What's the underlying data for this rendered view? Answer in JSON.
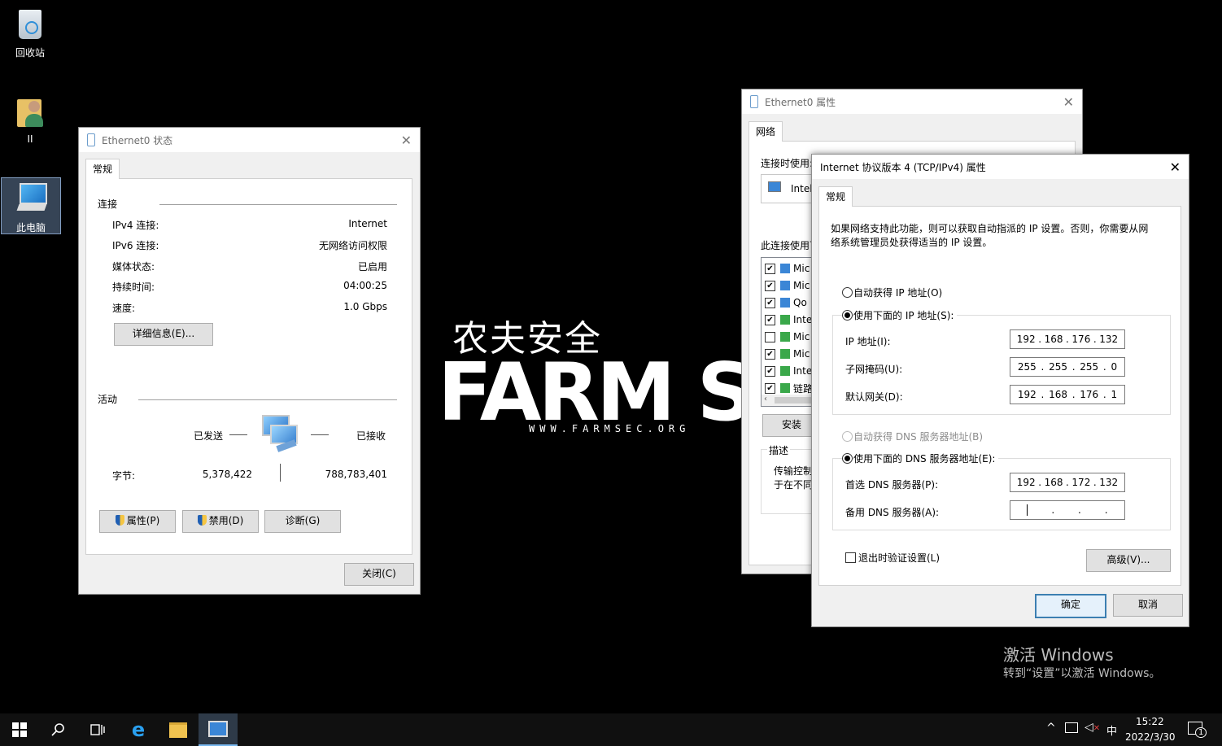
{
  "desktop": {
    "recycle_bin": "回收站",
    "user_folder": "II",
    "this_pc": "此电脑"
  },
  "watermark": {
    "cn": "农夫安全",
    "en": "FARM SEC",
    "url": "WWW.FARMSEC.ORG"
  },
  "status_window": {
    "title": "Ethernet0 状态",
    "tab": "常规",
    "connection_section": "连接",
    "rows": [
      {
        "label": "IPv4 连接:",
        "value": "Internet"
      },
      {
        "label": "IPv6 连接:",
        "value": "无网络访问权限"
      },
      {
        "label": "媒体状态:",
        "value": "已启用"
      },
      {
        "label": "持续时间:",
        "value": "04:00:25"
      },
      {
        "label": "速度:",
        "value": "1.0 Gbps"
      }
    ],
    "details_button": "详细信息(E)...",
    "activity_section": "活动",
    "sent_label": "已发送",
    "received_label": "已接收",
    "bytes_label": "字节:",
    "bytes_sent": "5,378,422",
    "bytes_received": "788,783,401",
    "properties_button": "属性(P)",
    "disable_button": "禁用(D)",
    "diagnose_button": "诊断(G)",
    "close_button": "关闭(C)"
  },
  "props_window": {
    "title": "Ethernet0 属性",
    "tab": "网络",
    "connect_using": "连接时使用:",
    "adapter_name": "Intel",
    "items_label": "此连接使用下",
    "items": [
      {
        "checked": true,
        "text": "Mic"
      },
      {
        "checked": true,
        "text": "Mic"
      },
      {
        "checked": true,
        "text": "Qo"
      },
      {
        "checked": true,
        "text": "Inte"
      },
      {
        "checked": false,
        "text": "Mic"
      },
      {
        "checked": true,
        "text": "Mic"
      },
      {
        "checked": true,
        "text": "Inte"
      },
      {
        "checked": true,
        "text": "链路"
      }
    ],
    "install_button": "安装",
    "desc_label": "描述",
    "desc_text_1": "传输控制",
    "desc_text_2": "于在不同"
  },
  "ipv4_window": {
    "title": "Internet 协议版本 4 (TCP/IPv4) 属性",
    "tab": "常规",
    "intro_line1": "如果网络支持此功能，则可以获取自动指派的 IP 设置。否则，你需要从网",
    "intro_line2": "络系统管理员处获得适当的 IP 设置。",
    "auto_ip": "自动获得 IP 地址(O)",
    "manual_ip": "使用下面的 IP 地址(S):",
    "ip_label": "IP 地址(I):",
    "ip_value": [
      "192",
      "168",
      "176",
      "132"
    ],
    "mask_label": "子网掩码(U):",
    "mask_value": [
      "255",
      "255",
      "255",
      "0"
    ],
    "gateway_label": "默认网关(D):",
    "gateway_value": [
      "192",
      "168",
      "176",
      "1"
    ],
    "auto_dns": "自动获得 DNS 服务器地址(B)",
    "manual_dns": "使用下面的 DNS 服务器地址(E):",
    "preferred_dns_label": "首选 DNS 服务器(P):",
    "preferred_dns_value": [
      "192",
      "168",
      "172",
      "132"
    ],
    "alternate_dns_label": "备用 DNS 服务器(A):",
    "alternate_dns_value": [
      "",
      "",
      "",
      ""
    ],
    "validate_label": "退出时验证设置(L)",
    "advanced_button": "高级(V)...",
    "ok_button": "确定",
    "cancel_button": "取消"
  },
  "activation": {
    "line1": "激活 Windows",
    "line2": "转到“设置”以激活 Windows。"
  },
  "taskbar": {
    "ime": "中",
    "time": "15:22",
    "date": "2022/3/30",
    "notification_count": "1"
  }
}
